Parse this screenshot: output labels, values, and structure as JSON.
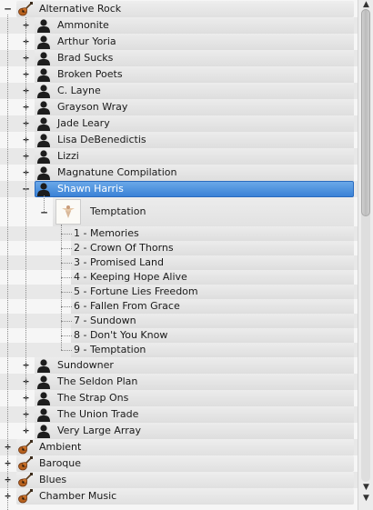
{
  "tree": {
    "genres_before": [
      {
        "label": "Alternative Rock",
        "expander": "–"
      }
    ],
    "artists": [
      {
        "label": "Ammonite",
        "expander": "+"
      },
      {
        "label": "Arthur Yoria",
        "expander": "+"
      },
      {
        "label": "Brad Sucks",
        "expander": "+"
      },
      {
        "label": "Broken Poets",
        "expander": "+"
      },
      {
        "label": "C. Layne",
        "expander": "+"
      },
      {
        "label": "Grayson Wray",
        "expander": "+"
      },
      {
        "label": "Jade Leary",
        "expander": "+"
      },
      {
        "label": "Lisa DeBenedictis",
        "expander": "+"
      },
      {
        "label": "Lizzi",
        "expander": "+"
      },
      {
        "label": "Magnatune Compilation",
        "expander": "+"
      },
      {
        "label": "Shawn Harris",
        "expander": "–",
        "selected": true
      }
    ],
    "album": {
      "label": "Temptation",
      "expander": "–"
    },
    "tracks": [
      "1 - Memories",
      "2 - Crown Of Thorns",
      "3 - Promised Land",
      "4 - Keeping Hope Alive",
      "5 - Fortune Lies Freedom",
      "6 - Fallen From Grace",
      "7 - Sundown",
      "8 - Don't You Know",
      "9 - Temptation"
    ],
    "artists_after": [
      {
        "label": "Sundowner",
        "expander": "+"
      },
      {
        "label": "The Seldon Plan",
        "expander": "+"
      },
      {
        "label": "The Strap Ons",
        "expander": "+"
      },
      {
        "label": "The Union Trade",
        "expander": "+"
      },
      {
        "label": "Very Large Array",
        "expander": "+"
      }
    ],
    "genres_after": [
      {
        "label": "Ambient",
        "expander": "+"
      },
      {
        "label": "Baroque",
        "expander": "+"
      },
      {
        "label": "Blues",
        "expander": "+"
      },
      {
        "label": "Chamber Music",
        "expander": "+"
      }
    ]
  },
  "icons": {
    "genre": "guitar-icon",
    "artist": "artist-silhouette-icon",
    "album": "album-cover-icon"
  },
  "scrollbar": {
    "up": "▲",
    "down": "▼",
    "position_fraction": 0.0,
    "visible_fraction": 0.44
  },
  "colors": {
    "selection": "#3b82d6",
    "selection_text": "#ffffff"
  }
}
